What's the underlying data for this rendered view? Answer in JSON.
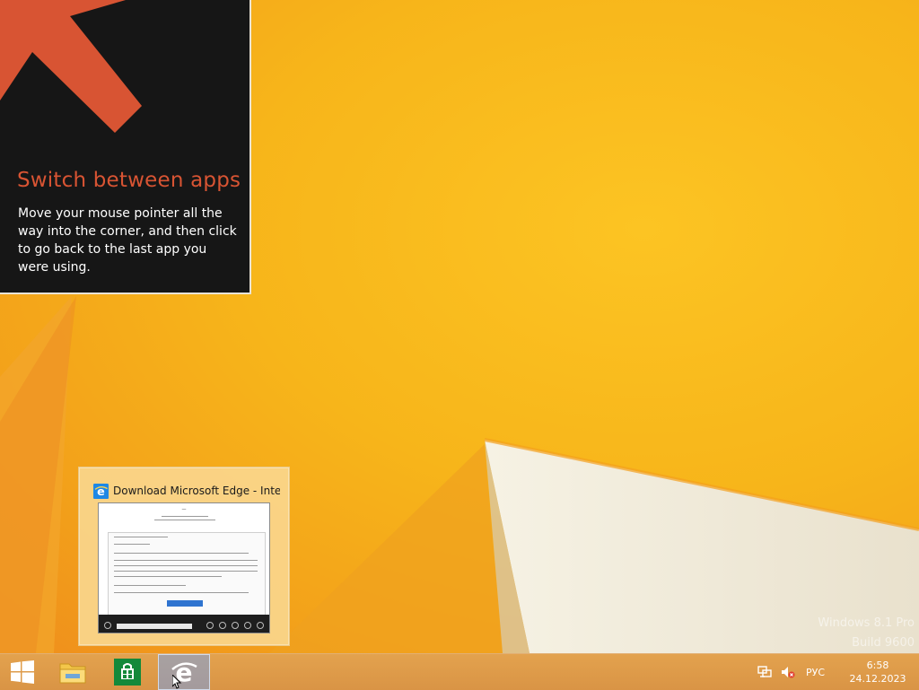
{
  "tip": {
    "title": "Switch between apps",
    "text": "Move your mouse pointer all the way into the corner, and then click to go back to the last app you were using."
  },
  "thumbnail": {
    "title": "Download Microsoft Edge - Inte..."
  },
  "watermark": {
    "line1": "Windows 8.1 Pro",
    "line2": "Build 9600"
  },
  "taskbar": {
    "start_icon": "windows-logo-icon",
    "pinned": [
      {
        "icon": "file-explorer-icon"
      },
      {
        "icon": "store-icon"
      },
      {
        "icon": "internet-explorer-icon",
        "active": true
      }
    ]
  },
  "tray": {
    "language": "РУС",
    "time": "6:58",
    "date": "24.12.2023",
    "icons": [
      "network-icon",
      "volume-muted-icon"
    ]
  },
  "colors": {
    "accent": "#d85433",
    "wallpaper": "#f6b416",
    "taskbar": "#dd9b48"
  }
}
